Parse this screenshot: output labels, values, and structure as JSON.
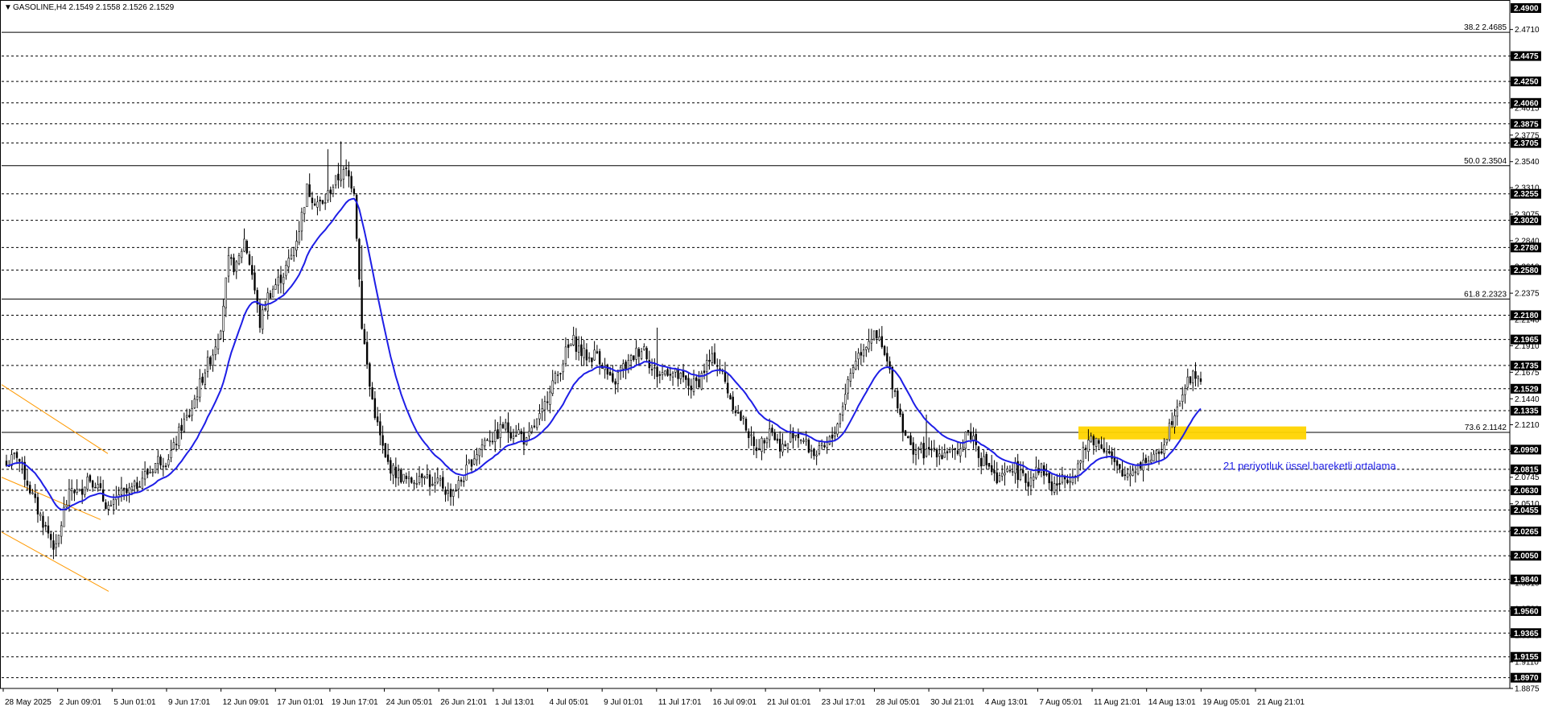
{
  "header": {
    "marker": "▼",
    "text": "GASOLINE,H4  2.1549 2.1558 2.1526 2.1529"
  },
  "chart_data": {
    "type": "candlestick",
    "symbol": "GASOLINE",
    "timeframe": "H4",
    "ohlc_last": {
      "open": 2.1549,
      "high": 2.1558,
      "low": 2.1526,
      "close": 2.1529
    },
    "ylim": [
      1.8875,
      2.49
    ],
    "grid": "horizontal dashed",
    "price_ticks_gray": [
      "2.4710",
      "2.4475",
      "2.4250",
      "2.4015",
      "2.3775",
      "2.3540",
      "2.3310",
      "2.3075",
      "2.2840",
      "2.2610",
      "2.2375",
      "2.2140",
      "2.1910",
      "2.1675",
      "2.1440",
      "2.1210",
      "2.0975",
      "2.0745",
      "2.0510",
      "2.0275",
      "2.0045",
      "1.9810",
      "1.9580",
      "1.9345",
      "1.9110",
      "1.8875"
    ],
    "price_boxes": [
      {
        "value": 2.49,
        "label": "2.4900"
      },
      {
        "value": 2.4475,
        "label": "2.4475"
      },
      {
        "value": 2.425,
        "label": "2.4250"
      },
      {
        "value": 2.406,
        "label": "2.4060"
      },
      {
        "value": 2.3875,
        "label": "2.3875"
      },
      {
        "value": 2.3705,
        "label": "2.3705"
      },
      {
        "value": 2.3255,
        "label": "2.3255"
      },
      {
        "value": 2.302,
        "label": "2.3020"
      },
      {
        "value": 2.278,
        "label": "2.2780"
      },
      {
        "value": 2.258,
        "label": "2.2580"
      },
      {
        "value": 2.218,
        "label": "2.2180"
      },
      {
        "value": 2.1965,
        "label": "2.1965"
      },
      {
        "value": 2.1735,
        "label": "2.1735"
      },
      {
        "value": 2.1529,
        "label": "2.1529"
      },
      {
        "value": 2.1335,
        "label": "2.1335"
      },
      {
        "value": 2.099,
        "label": "2.0990"
      },
      {
        "value": 2.0815,
        "label": "2.0815"
      },
      {
        "value": 2.063,
        "label": "2.0630"
      },
      {
        "value": 2.0455,
        "label": "2.0455"
      },
      {
        "value": 2.0265,
        "label": "2.0265"
      },
      {
        "value": 2.005,
        "label": "2.0050"
      },
      {
        "value": 1.984,
        "label": "1.9840"
      },
      {
        "value": 1.956,
        "label": "1.9560"
      },
      {
        "value": 1.9365,
        "label": "1.9365"
      },
      {
        "value": 1.9155,
        "label": "1.9155"
      },
      {
        "value": 1.897,
        "label": "1.8970"
      }
    ],
    "fib_levels": [
      {
        "label": "38.2 2.4685",
        "value": 2.4685
      },
      {
        "label": "50.0 2.3504",
        "value": 2.3504
      },
      {
        "label": "61.8 2.2323",
        "value": 2.2323
      },
      {
        "label": "73.6 2.1142",
        "value": 2.1142
      }
    ],
    "date_labels": [
      "28 May 2025",
      "2 Jun 09:01",
      "5 Jun 01:01",
      "9 Jun 17:01",
      "12 Jun 09:01",
      "17 Jun 01:01",
      "19 Jun 17:01",
      "24 Jun 05:01",
      "26 Jun 21:01",
      "1 Jul 13:01",
      "4 Jul 05:01",
      "9 Jul 01:01",
      "11 Jul 17:01",
      "16 Jul 09:01",
      "21 Jul 01:01",
      "23 Jul 17:01",
      "28 Jul 05:01",
      "30 Jul 21:01",
      "4 Aug 13:01",
      "7 Aug 05:01",
      "11 Aug 21:01",
      "14 Aug 13:01",
      "19 Aug 05:01",
      "21 Aug 21:01"
    ],
    "close_path": [
      [
        0,
        2.085
      ],
      [
        4,
        2.095
      ],
      [
        8,
        2.07
      ],
      [
        12,
        2.045
      ],
      [
        16,
        2.025
      ],
      [
        19,
        2.01
      ],
      [
        22,
        2.045
      ],
      [
        25,
        2.065
      ],
      [
        28,
        2.06
      ],
      [
        31,
        2.075
      ],
      [
        34,
        2.07
      ],
      [
        37,
        2.055
      ],
      [
        40,
        2.045
      ],
      [
        43,
        2.06
      ],
      [
        46,
        2.06
      ],
      [
        49,
        2.065
      ],
      [
        52,
        2.075
      ],
      [
        55,
        2.08
      ],
      [
        58,
        2.09
      ],
      [
        61,
        2.09
      ],
      [
        64,
        2.1
      ],
      [
        67,
        2.12
      ],
      [
        70,
        2.13
      ],
      [
        73,
        2.15
      ],
      [
        76,
        2.17
      ],
      [
        79,
        2.185
      ],
      [
        82,
        2.21
      ],
      [
        85,
        2.265
      ],
      [
        88,
        2.26
      ],
      [
        91,
        2.285
      ],
      [
        94,
        2.255
      ],
      [
        97,
        2.21
      ],
      [
        100,
        2.235
      ],
      [
        103,
        2.245
      ],
      [
        106,
        2.255
      ],
      [
        109,
        2.27
      ],
      [
        112,
        2.295
      ],
      [
        115,
        2.33
      ],
      [
        118,
        2.32
      ],
      [
        121,
        2.315
      ],
      [
        124,
        2.33
      ],
      [
        127,
        2.34
      ],
      [
        130,
        2.345
      ],
      [
        133,
        2.33
      ],
      [
        136,
        2.21
      ],
      [
        139,
        2.155
      ],
      [
        142,
        2.12
      ],
      [
        145,
        2.09
      ],
      [
        148,
        2.08
      ],
      [
        151,
        2.075
      ],
      [
        154,
        2.07
      ],
      [
        157,
        2.075
      ],
      [
        160,
        2.08
      ],
      [
        163,
        2.065
      ],
      [
        166,
        2.07
      ],
      [
        169,
        2.06
      ],
      [
        172,
        2.065
      ],
      [
        175,
        2.075
      ],
      [
        178,
        2.09
      ],
      [
        181,
        2.1
      ],
      [
        184,
        2.11
      ],
      [
        187,
        2.11
      ],
      [
        190,
        2.12
      ],
      [
        193,
        2.115
      ],
      [
        196,
        2.115
      ],
      [
        199,
        2.105
      ],
      [
        202,
        2.12
      ],
      [
        205,
        2.13
      ],
      [
        208,
        2.155
      ],
      [
        211,
        2.165
      ],
      [
        214,
        2.185
      ],
      [
        217,
        2.195
      ],
      [
        220,
        2.185
      ],
      [
        223,
        2.18
      ],
      [
        226,
        2.185
      ],
      [
        229,
        2.17
      ],
      [
        232,
        2.155
      ],
      [
        235,
        2.17
      ],
      [
        238,
        2.175
      ],
      [
        241,
        2.185
      ],
      [
        244,
        2.19
      ],
      [
        247,
        2.17
      ],
      [
        250,
        2.165
      ],
      [
        253,
        2.17
      ],
      [
        256,
        2.165
      ],
      [
        259,
        2.16
      ],
      [
        262,
        2.155
      ],
      [
        265,
        2.16
      ],
      [
        268,
        2.175
      ],
      [
        271,
        2.18
      ],
      [
        274,
        2.165
      ],
      [
        277,
        2.145
      ],
      [
        280,
        2.13
      ],
      [
        283,
        2.12
      ],
      [
        286,
        2.1
      ],
      [
        289,
        2.105
      ],
      [
        292,
        2.12
      ],
      [
        295,
        2.105
      ],
      [
        298,
        2.1
      ],
      [
        301,
        2.115
      ],
      [
        304,
        2.11
      ],
      [
        307,
        2.1
      ],
      [
        310,
        2.095
      ],
      [
        313,
        2.1
      ],
      [
        316,
        2.11
      ],
      [
        319,
        2.13
      ],
      [
        322,
        2.16
      ],
      [
        325,
        2.18
      ],
      [
        328,
        2.19
      ],
      [
        331,
        2.2
      ],
      [
        334,
        2.195
      ],
      [
        337,
        2.175
      ],
      [
        340,
        2.15
      ],
      [
        343,
        2.12
      ],
      [
        346,
        2.1
      ],
      [
        349,
        2.1
      ],
      [
        352,
        2.095
      ],
      [
        355,
        2.1
      ],
      [
        358,
        2.095
      ],
      [
        361,
        2.1
      ],
      [
        364,
        2.09
      ],
      [
        367,
        2.115
      ],
      [
        370,
        2.11
      ],
      [
        373,
        2.09
      ],
      [
        376,
        2.085
      ],
      [
        379,
        2.07
      ],
      [
        382,
        2.075
      ],
      [
        385,
        2.085
      ],
      [
        388,
        2.075
      ],
      [
        391,
        2.07
      ],
      [
        394,
        2.085
      ],
      [
        397,
        2.08
      ],
      [
        400,
        2.065
      ],
      [
        403,
        2.07
      ],
      [
        406,
        2.075
      ],
      [
        409,
        2.08
      ],
      [
        412,
        2.095
      ],
      [
        415,
        2.11
      ],
      [
        418,
        2.105
      ],
      [
        421,
        2.1
      ],
      [
        424,
        2.085
      ],
      [
        427,
        2.075
      ],
      [
        430,
        2.08
      ],
      [
        433,
        2.085
      ],
      [
        436,
        2.09
      ],
      [
        439,
        2.09
      ],
      [
        442,
        2.1
      ],
      [
        445,
        2.12
      ],
      [
        448,
        2.14
      ],
      [
        451,
        2.155
      ],
      [
        454,
        2.165
      ],
      [
        457,
        2.163
      ]
    ],
    "ema_label": "21 periyotluk üssel hareketli ortalama",
    "colors": {
      "ema": "#1e1ee6",
      "candle": "#000000",
      "highlight": "#ffd400",
      "channel": "#ff9900",
      "grid": "#000000",
      "box": "#000000",
      "annotation": "#1e1ee6"
    }
  }
}
